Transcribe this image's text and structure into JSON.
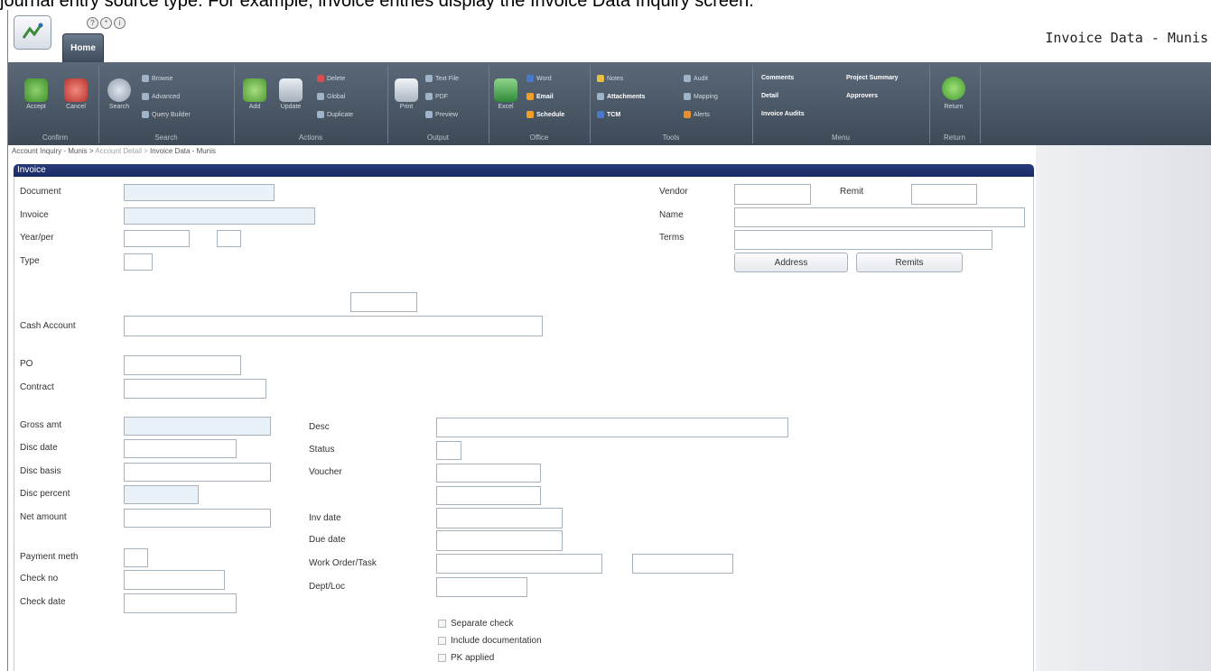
{
  "caption": "journal entry source type. For example, invoice entries display the Invoice Data Inquiry screen.",
  "app": {
    "title": "Invoice Data - Munis",
    "home_tab": "Home"
  },
  "ribbon": {
    "groups": {
      "confirm": "Confirm",
      "search": "Search",
      "actions": "Actions",
      "output": "Output",
      "office": "Office",
      "tools": "Tools",
      "menu": "Menu",
      "return": "Return"
    },
    "accept": "Accept",
    "cancel": "Cancel",
    "search": "Search",
    "browse": "Browse",
    "advanced": "Advanced",
    "query_builder": "Query Builder",
    "add": "Add",
    "update": "Update",
    "delete": "Delete",
    "global": "Global",
    "duplicate": "Duplicate",
    "print": "Print",
    "text_file": "Text File",
    "pdf": "PDF",
    "preview": "Preview",
    "excel": "Excel",
    "word": "Word",
    "email": "Email",
    "schedule": "Schedule",
    "notes": "Notes",
    "attachments": "Attachments",
    "tcm": "TCM",
    "audit": "Audit",
    "mapping": "Mapping",
    "alerts": "Alerts",
    "comments": "Comments",
    "detail": "Detail",
    "invoice_audits": "Invoice Audits",
    "project_summary": "Project Summary",
    "approvers": "Approvers",
    "return_label": "Return"
  },
  "breadcrumb": {
    "first": "Account Inquiry - Munis >",
    "second": "Account Detail >",
    "third": "Invoice Data - Munis"
  },
  "panel": {
    "title": "Invoice"
  },
  "form": {
    "document": {
      "label": "Document",
      "value": ""
    },
    "invoice": {
      "label": "Invoice",
      "value": ""
    },
    "yearper": {
      "label": "Year/per",
      "value": "",
      "value2": ""
    },
    "type": {
      "label": "Type",
      "value": ""
    },
    "cash_account": {
      "label": "Cash Account",
      "value": ""
    },
    "po": {
      "label": "PO",
      "value": ""
    },
    "contract": {
      "label": "Contract",
      "value": ""
    },
    "gross_amt": {
      "label": "Gross amt",
      "value": ""
    },
    "disc_date": {
      "label": "Disc date",
      "value": ""
    },
    "disc_basis": {
      "label": "Disc basis",
      "value": ""
    },
    "disc_percent": {
      "label": "Disc percent",
      "value": ""
    },
    "net_amount": {
      "label": "Net amount",
      "value": ""
    },
    "payment_meth": {
      "label": "Payment meth",
      "value": ""
    },
    "check_no": {
      "label": "Check no",
      "value": ""
    },
    "check_date": {
      "label": "Check date",
      "value": ""
    },
    "vendor": {
      "label": "Vendor",
      "value": ""
    },
    "remit": {
      "label": "Remit",
      "value": ""
    },
    "name": {
      "label": "Name",
      "value": ""
    },
    "terms": {
      "label": "Terms",
      "value": ""
    },
    "address_button": "Address",
    "remits_button": "Remits",
    "desc": {
      "label": "Desc",
      "value": ""
    },
    "status": {
      "label": "Status",
      "value": ""
    },
    "voucher": {
      "label": "Voucher",
      "value": ""
    },
    "inv_date": {
      "label": "Inv date",
      "value": ""
    },
    "due_date": {
      "label": "Due date",
      "value": ""
    },
    "work_order": {
      "label": "Work Order/Task",
      "value": "",
      "value2": ""
    },
    "dept_loc": {
      "label": "Dept/Loc",
      "value": ""
    },
    "checks": {
      "separate_check": "Separate check",
      "include_documentation": "Include documentation",
      "pk_applied": "PK applied"
    }
  }
}
